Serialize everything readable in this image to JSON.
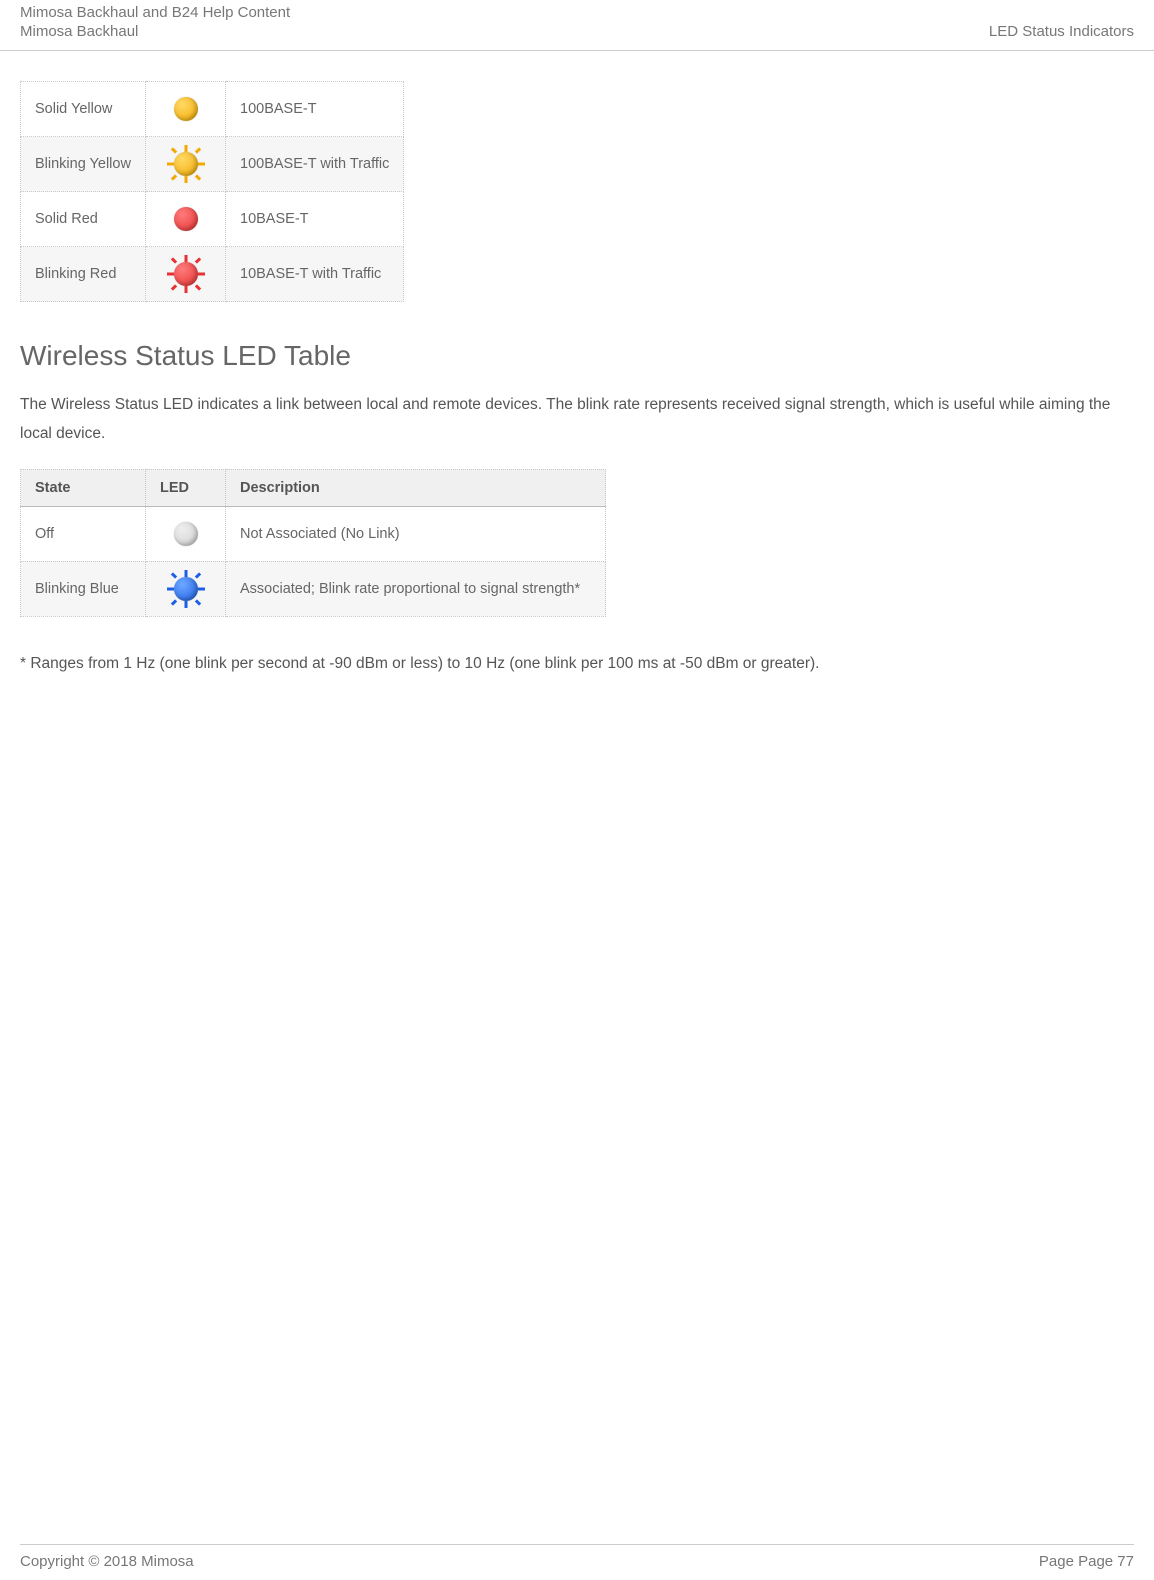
{
  "header": {
    "title_line1": "Mimosa Backhaul and B24 Help Content",
    "title_line2": "Mimosa Backhaul",
    "right": "LED Status Indicators"
  },
  "ethernet_table": {
    "rows": [
      {
        "state": "Solid Yellow",
        "led_type": "solid",
        "color": "yellow",
        "desc": "100BASE-T"
      },
      {
        "state": "Blinking Yellow",
        "led_type": "blink",
        "color": "yellow",
        "desc": "100BASE-T with Traffic"
      },
      {
        "state": "Solid Red",
        "led_type": "solid",
        "color": "red",
        "desc": "10BASE-T"
      },
      {
        "state": "Blinking Red",
        "led_type": "blink",
        "color": "red",
        "desc": "10BASE-T with Traffic"
      }
    ]
  },
  "wireless_section": {
    "title": "Wireless Status LED Table",
    "paragraph": "The Wireless Status LED indicates a link between local and remote devices. The blink rate represents received signal strength, which is useful while aiming the local device.",
    "headers": {
      "state": "State",
      "led": "LED",
      "desc": "Description"
    },
    "rows": [
      {
        "state": "Off",
        "led_type": "solid",
        "color": "gray",
        "desc": "Not Associated (No Link)"
      },
      {
        "state": "Blinking Blue",
        "led_type": "blink",
        "color": "blue",
        "desc": "Associated; Blink rate proportional to signal strength*"
      }
    ],
    "footnote": "* Ranges from 1 Hz (one blink per second at -90 dBm or less) to 10 Hz (one blink per 100 ms at -50 dBm or greater)."
  },
  "footer": {
    "left": "Copyright © 2018 Mimosa",
    "right": "Page Page 77"
  }
}
